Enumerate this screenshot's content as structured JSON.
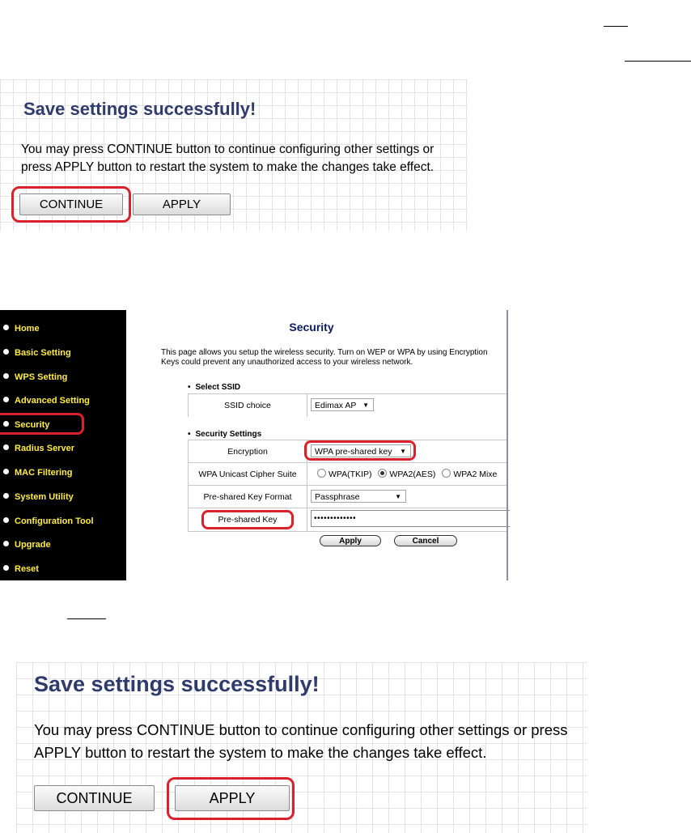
{
  "top_save_dialog": {
    "title": "Save settings successfully!",
    "message": "You may press CONTINUE button to continue configuring other settings or press APPLY button to restart the system to make the changes take effect.",
    "continue_label": "CONTINUE",
    "apply_label": "APPLY",
    "highlighted": "CONTINUE"
  },
  "security_page": {
    "nav": [
      "Home",
      "Basic Setting",
      "WPS Setting",
      "Advanced Setting",
      "Security",
      "Radius Server",
      "MAC Filtering",
      "System Utility",
      "Configuration Tool",
      "Upgrade",
      "Reset"
    ],
    "highlighted_nav": "Security",
    "title": "Security",
    "description": "This page allows you setup the wireless security. Turn on WEP or WPA by using Encryption Keys could prevent any unauthorized access to your wireless network.",
    "select_ssid_heading": "Select SSID",
    "ssid_choice_label": "SSID choice",
    "ssid_choice_value": "Edimax AP",
    "security_settings_heading": "Security Settings",
    "encryption_label": "Encryption",
    "encryption_value": "WPA pre-shared key",
    "cipher_label": "WPA Unicast Cipher Suite",
    "cipher_options": [
      "WPA(TKIP)",
      "WPA2(AES)",
      "WPA2 Mixe"
    ],
    "cipher_selected": "WPA2(AES)",
    "key_format_label": "Pre-shared Key Format",
    "key_format_value": "Passphrase",
    "key_label": "Pre-shared Key",
    "key_value": "•••••••••••••",
    "apply_label": "Apply",
    "cancel_label": "Cancel",
    "accent_color": "#0b1b63",
    "nav_text_color": "#ffec45",
    "highlight_color": "#d9222b"
  },
  "bottom_save_dialog": {
    "title": "Save settings successfully!",
    "message": "You may press CONTINUE button to continue configuring other settings or press APPLY button to restart the system to make the changes take effect.",
    "continue_label": "CONTINUE",
    "apply_label": "APPLY",
    "highlighted": "APPLY"
  }
}
